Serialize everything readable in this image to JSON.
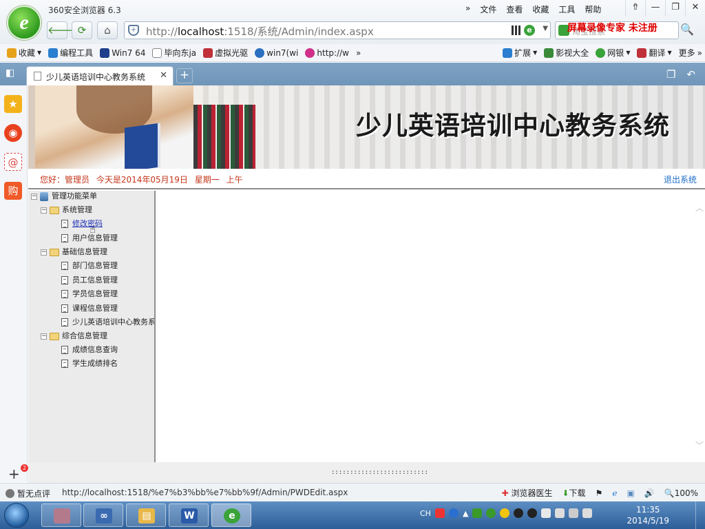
{
  "browser": {
    "app_title": "360安全浏览器 6.3",
    "logo_glyph": "e",
    "menu": [
      "文件",
      "查看",
      "收藏",
      "工具",
      "帮助"
    ],
    "window_controls": [
      "⇮",
      "—",
      "❐",
      "✕"
    ],
    "nav": {
      "back": "🡐",
      "refresh": "⟳",
      "home": "⌂"
    },
    "address": {
      "prefix": "http://",
      "host": "localhost",
      "rest": ":1518/系统/Admin/index.aspx"
    },
    "search": {
      "placeholder": "淘宝搜索",
      "overlay": "屏幕录像专家  未注册"
    }
  },
  "bookmarks": {
    "items": [
      {
        "label": "收藏",
        "color": "#e6a21a"
      },
      {
        "label": "编程工具",
        "color": "#2a7fd0"
      },
      {
        "label": "Win7 64",
        "color": "#1e3e8c"
      },
      {
        "label": "毕向东ja",
        "color": "#888888"
      },
      {
        "label": "虚拟光驱",
        "color": "#c0303a"
      },
      {
        "label": "win7(wi",
        "color": "#2a6fc0"
      },
      {
        "label": "http://w",
        "color": "#d0308a"
      }
    ],
    "more": "»",
    "right": [
      "扩展",
      "影视大全",
      "网银",
      "翻译",
      "更多"
    ]
  },
  "tabs": {
    "active_label": "少儿英语培训中心教务系统",
    "close": "✕",
    "new_tab": "+",
    "sidebar_toggle": "◧"
  },
  "leftbar": {
    "add": "+",
    "badge": "2"
  },
  "page": {
    "banner_title": "少儿英语培训中心教务系统",
    "greeting": "您好：管理员  今天是2014年05月19日  星期一  上午",
    "logout": "退出系统"
  },
  "tree": {
    "root": "管理功能菜单",
    "groups": [
      {
        "label": "系统管理",
        "items": [
          "修改密码",
          "用户信息管理"
        ]
      },
      {
        "label": "基础信息管理",
        "items": [
          "部门信息管理",
          "员工信息管理",
          "学员信息管理",
          "课程信息管理",
          "少儿英语培训中心教务系"
        ]
      },
      {
        "label": "综合信息管理",
        "items": [
          "成绩信息查询",
          "学生成绩排名"
        ]
      }
    ],
    "toggle_symbol": "−"
  },
  "splitter": {
    "grip": "::::::::::::::::::::::::::"
  },
  "status": {
    "rating": "暂无点评",
    "url": "http://localhost:1518/%e7%b3%bb%e7%bb%9f/Admin/PWDEdit.aspx",
    "doctor": "浏览器医生",
    "download": "下载",
    "zoom": "100%"
  },
  "taskbar": {
    "tray_lang": "CH",
    "time": "11:35",
    "date": "2014/5/19",
    "apps": [
      {
        "glyph": "",
        "color": "#b37a8c"
      },
      {
        "glyph": "∞",
        "color": "#3a6ab0"
      },
      {
        "glyph": "▤",
        "color": "#e8b84a"
      },
      {
        "glyph": "W",
        "color": "#2a5aa8"
      },
      {
        "glyph": "e",
        "color": "#3aa33a"
      }
    ]
  }
}
